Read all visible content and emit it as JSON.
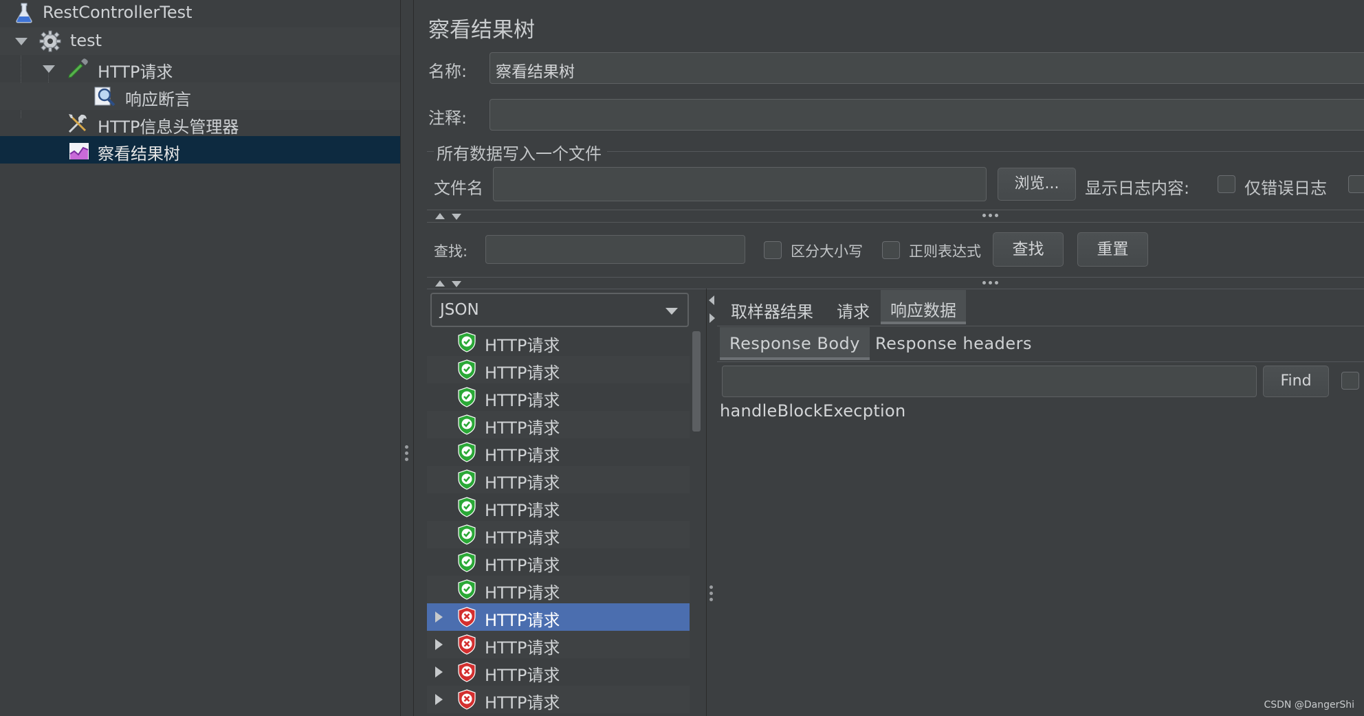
{
  "tree": {
    "items": [
      {
        "label": "RestControllerTest",
        "icon": "flask-icon"
      },
      {
        "label": "test",
        "icon": "gear-icon",
        "expanded": true
      },
      {
        "label": "HTTP请求",
        "icon": "pipette-icon",
        "expanded": true
      },
      {
        "label": "响应断言",
        "icon": "magnifier-icon"
      },
      {
        "label": "HTTP信息头管理器",
        "icon": "tools-icon"
      },
      {
        "label": "察看结果树",
        "icon": "chart-icon",
        "selected": true
      }
    ]
  },
  "panel": {
    "title": "察看结果树",
    "name_label": "名称:",
    "name_value": "察看结果树",
    "comment_label": "注释:",
    "comment_value": "",
    "file_section_title": "所有数据写入一个文件",
    "filename_label": "文件名",
    "filename_value": "",
    "browse_button": "浏览...",
    "log_content_label": "显示日志内容:",
    "errors_only_label": "仅错误日志"
  },
  "search": {
    "label": "查找:",
    "value": "",
    "case_sensitive_label": "区分大小写",
    "regex_label": "正则表达式",
    "find_button": "查找",
    "reset_button": "重置"
  },
  "renderer": {
    "selected": "JSON"
  },
  "results": [
    {
      "label": "HTTP请求",
      "status": "success"
    },
    {
      "label": "HTTP请求",
      "status": "success"
    },
    {
      "label": "HTTP请求",
      "status": "success"
    },
    {
      "label": "HTTP请求",
      "status": "success"
    },
    {
      "label": "HTTP请求",
      "status": "success"
    },
    {
      "label": "HTTP请求",
      "status": "success"
    },
    {
      "label": "HTTP请求",
      "status": "success"
    },
    {
      "label": "HTTP请求",
      "status": "success"
    },
    {
      "label": "HTTP请求",
      "status": "success"
    },
    {
      "label": "HTTP请求",
      "status": "success"
    },
    {
      "label": "HTTP请求",
      "status": "failure",
      "selected": true
    },
    {
      "label": "HTTP请求",
      "status": "failure"
    },
    {
      "label": "HTTP请求",
      "status": "failure"
    },
    {
      "label": "HTTP请求",
      "status": "failure"
    }
  ],
  "tabs": {
    "items": [
      "取样器结果",
      "请求",
      "响应数据"
    ],
    "active": "响应数据"
  },
  "subtabs": {
    "items": [
      "Response Body",
      "Response headers"
    ],
    "active": "Response Body"
  },
  "response": {
    "find_value": "",
    "find_button": "Find",
    "body": "handleBlockExecption"
  },
  "watermark": "CSDN @DangerShi",
  "colors": {
    "background": "#3c3f41",
    "selected_tree": "#0d2a40",
    "selected_result": "#4b6eaf",
    "success": "#2aa836",
    "failure": "#d32f2f"
  }
}
